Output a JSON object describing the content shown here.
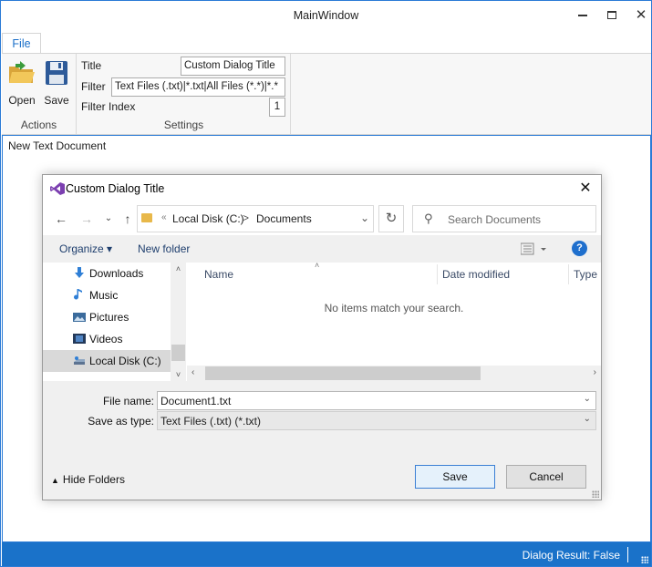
{
  "window": {
    "title": "MainWindow",
    "controls": {
      "minimize": "—",
      "maximize": "□",
      "close": "✕"
    }
  },
  "ribbon": {
    "tab": "File",
    "actions": {
      "group_label": "Actions",
      "open_label": "Open",
      "save_label": "Save"
    },
    "settings": {
      "group_label": "Settings",
      "title_label": "Title",
      "title_value": "Custom Dialog Title",
      "filter_label": "Filter",
      "filter_value": "Text Files (.txt)|*.txt|All Files (*.*)|*.*",
      "filter_index_label": "Filter Index",
      "filter_index_value": "1"
    }
  },
  "document": {
    "text": "New Text Document"
  },
  "status": {
    "text": "Dialog Result: False"
  },
  "dialog": {
    "title": "Custom Dialog Title",
    "close": "✕",
    "address": {
      "crumb_chevron": "«",
      "crumbs": [
        "Local Disk (C:)",
        "Documents"
      ],
      "separator": ">"
    },
    "search_placeholder": "Search Documents",
    "commands": {
      "organize": "Organize ▾",
      "new_folder": "New folder",
      "help": "?"
    },
    "nav_items": [
      {
        "label": "Downloads",
        "icon": "download-icon"
      },
      {
        "label": "Music",
        "icon": "music-note-icon"
      },
      {
        "label": "Pictures",
        "icon": "pictures-icon"
      },
      {
        "label": "Videos",
        "icon": "video-icon"
      },
      {
        "label": "Local Disk (C:)",
        "icon": "drive-icon",
        "selected": true
      }
    ],
    "columns": [
      "Name",
      "Date modified",
      "Type"
    ],
    "empty_message": "No items match your search.",
    "file_name_label": "File name:",
    "file_name_value": "Document1.txt",
    "save_type_label": "Save as type:",
    "save_type_value": "Text Files (.txt) (*.txt)",
    "hide_folders": "Hide Folders",
    "save_button": "Save",
    "cancel_button": "Cancel"
  },
  "colors": {
    "accent": "#1a72c9",
    "window_border": "#2b7bd6",
    "tab_text": "#1a6fc9"
  }
}
